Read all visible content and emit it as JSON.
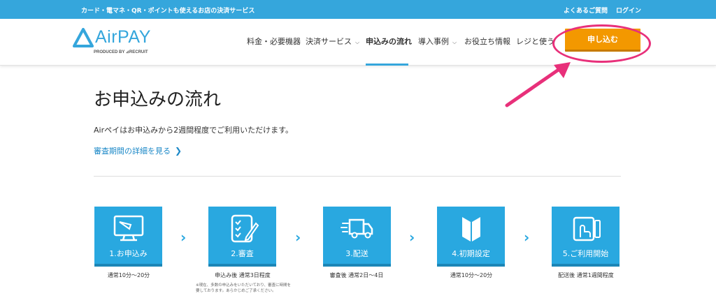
{
  "topbar": {
    "tagline": "カード・電マネ・QR・ポイントも使えるお店の決済サービス",
    "faq": "よくあるご質問",
    "login": "ログイン"
  },
  "header": {
    "logo_text": "AirPAY",
    "logo_sub": "PRODUCED BY ⊿RECRUIT",
    "nav": [
      {
        "label": "料金・必要機器"
      },
      {
        "label": "決済サービス"
      },
      {
        "label": "申込みの流れ"
      },
      {
        "label": "導入事例"
      },
      {
        "label": "お役立ち情報"
      },
      {
        "label": "レジと使う"
      }
    ],
    "apply_label": "申し込む",
    "accent": "#35a6dc",
    "apply_color": "#f39800",
    "highlight_color": "#e8307a"
  },
  "main": {
    "title": "お申込みの流れ",
    "lead": "Airペイはお申込みから2週間程度でご利用いただけます。",
    "link": "審査期間の詳細を見る",
    "steps": [
      {
        "label": "1.お申込み",
        "note": "通常10分〜20分",
        "icon": "monitor-icon"
      },
      {
        "label": "2.審査",
        "note": "申込み後 通常3日程度",
        "icon": "checklist-icon"
      },
      {
        "label": "3.配送",
        "note": "審査後 通常2日〜4日",
        "icon": "truck-icon"
      },
      {
        "label": "4.初期設定",
        "note": "通常10分〜20分",
        "icon": "beginner-mark-icon"
      },
      {
        "label": "5.ご利用開始",
        "note": "配送後 通常1週間程度",
        "icon": "card-reader-icon"
      }
    ],
    "footnote_line1": "※現在、多数の申込みをいただいており、審査に時間を",
    "footnote_line2": "要しております。あらかじめご了承ください。"
  }
}
